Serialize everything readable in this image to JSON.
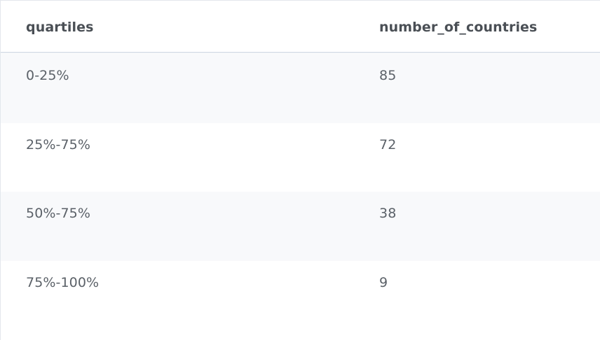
{
  "table": {
    "columns": [
      "quartiles",
      "number_of_countries"
    ],
    "rows": [
      [
        "0-25%",
        "85"
      ],
      [
        "25%-75%",
        "72"
      ],
      [
        "50%-75%",
        "38"
      ],
      [
        "75%-100%",
        "9"
      ]
    ]
  }
}
